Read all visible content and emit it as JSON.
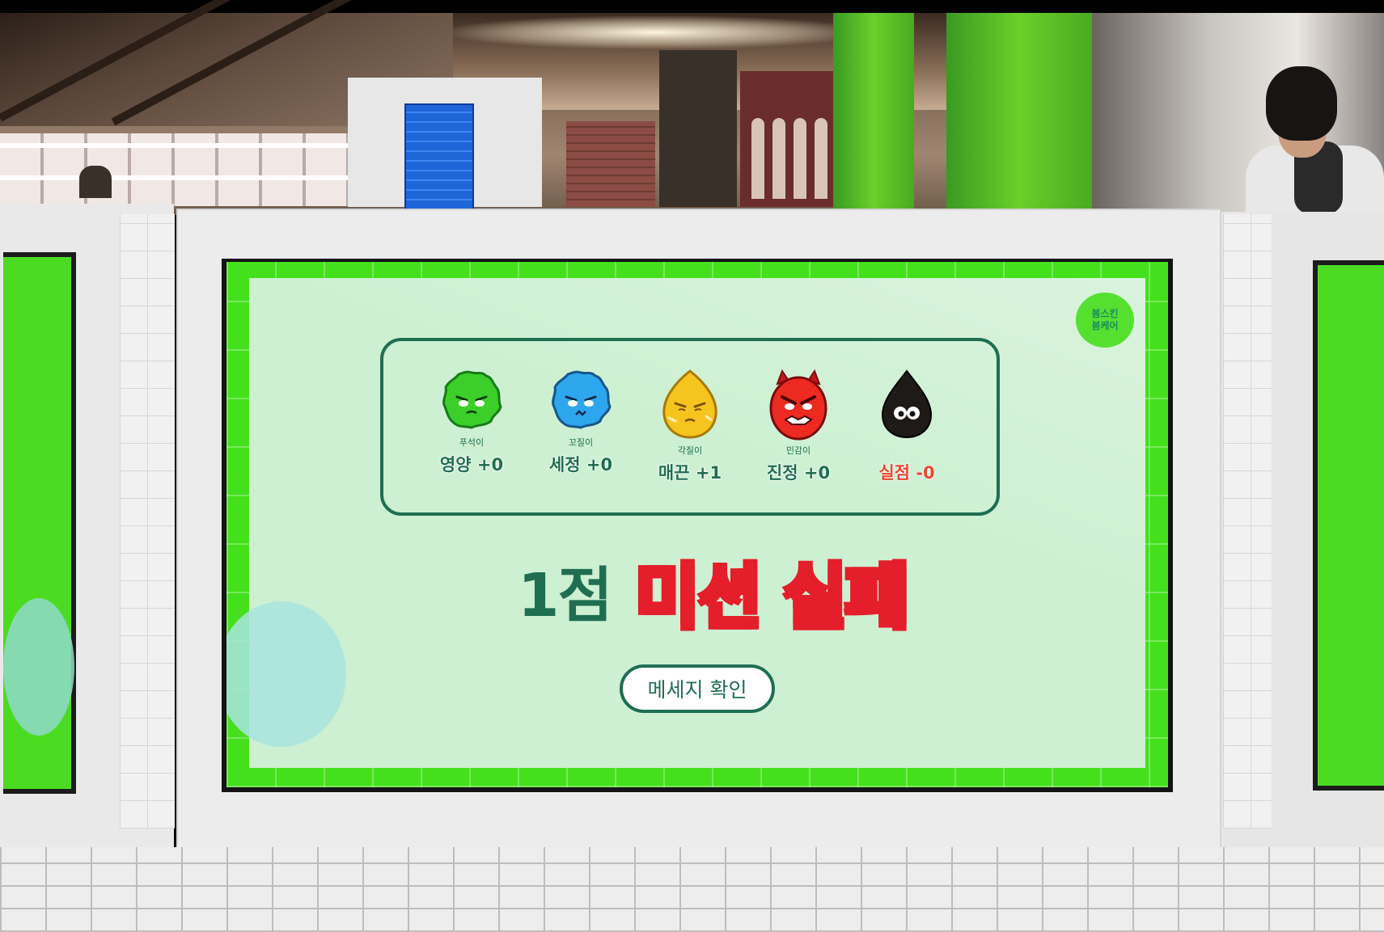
{
  "colors": {
    "screen_green": "#44e01c",
    "panel_mint": "#cdf0d2",
    "brand_dark_green": "#1f6e52",
    "fail_red": "#e41e2a",
    "stat_fail_orange": "#e8472e"
  },
  "logo": {
    "icon": "round-green-logo-badge",
    "line1": "봄스킨",
    "line2": "봄케어"
  },
  "characters": [
    {
      "icon": "green-fuzzy-character-icon",
      "name": "푸석이",
      "stat": "영양 +0"
    },
    {
      "icon": "blue-fuzzy-character-icon",
      "name": "꼬질이",
      "stat": "세정 +0"
    },
    {
      "icon": "yellow-drop-character-icon",
      "name": "각질이",
      "stat": "매끈 +1"
    },
    {
      "icon": "red-devil-character-icon",
      "name": "민감이",
      "stat": "진정 +0"
    },
    {
      "icon": "black-drop-character-icon",
      "name": "",
      "stat": "실점 -0"
    }
  ],
  "result": {
    "score": "1점",
    "mission": "미션 실패"
  },
  "button": {
    "label": "메세지 확인"
  }
}
